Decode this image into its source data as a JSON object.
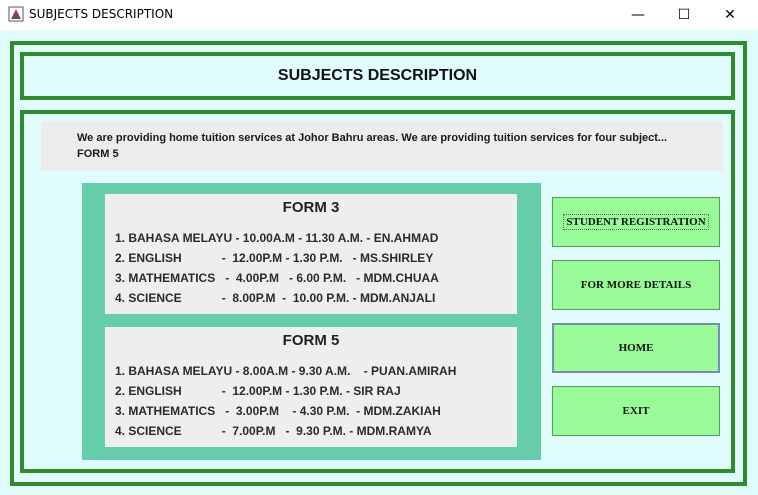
{
  "window": {
    "title": "SUBJECTS DESCRIPTION",
    "minimize_glyph": "—",
    "maximize_glyph": "☐",
    "close_glyph": "✕"
  },
  "header": {
    "title": "SUBJECTS DESCRIPTION"
  },
  "intro": {
    "line1": "We are providing home tuition services at Johor Bahru areas. We are providing tuition services for four subject...",
    "line2": "FORM 5"
  },
  "form3": {
    "title": "FORM 3",
    "rows": [
      "1. BAHASA MELAYU - 10.00A.M - 11.30 A.M. - EN.AHMAD",
      "2. ENGLISH            -  12.00P.M - 1.30 P.M.   - MS.SHIRLEY",
      "3. MATHEMATICS   -  4.00P.M   - 6.00 P.M.   - MDM.CHUAA",
      "4. SCIENCE            -  8.00P.M  -  10.00 P.M. - MDM.ANJALI"
    ]
  },
  "form5": {
    "title": "FORM 5",
    "rows": [
      "1. BAHASA MELAYU - 8.00A.M - 9.30 A.M.    - PUAN.AMIRAH",
      "2. ENGLISH            -  12.00P.M - 1.30 P.M. - SIR RAJ",
      "3. MATHEMATICS   -  3.00P.M    - 4.30 P.M.  - MDM.ZAKIAH",
      "4. SCIENCE            -  7.00P.M   -  9.30 P.M. - MDM.RAMYA"
    ]
  },
  "buttons": {
    "student_registration": "STUDENT REGISTRATION",
    "more_details": "FOR MORE DETAILS",
    "home": "HOME",
    "exit": "EXIT"
  },
  "colors": {
    "border_green": "#2e8b2e",
    "background": "#e0fcfc",
    "panel": "#66cdaa",
    "button": "#98fb98"
  }
}
